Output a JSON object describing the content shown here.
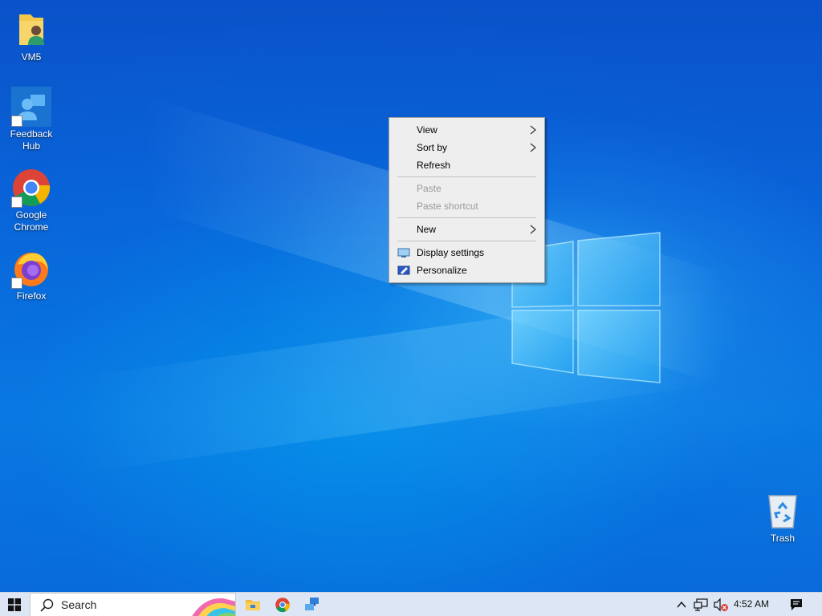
{
  "desktop": {
    "icons": [
      {
        "label": "VM5",
        "icon": "user-folder-icon"
      },
      {
        "label": "Feedback Hub",
        "icon": "feedback-hub-icon"
      },
      {
        "label": "Google Chrome",
        "icon": "chrome-icon"
      },
      {
        "label": "Firefox",
        "icon": "firefox-icon"
      },
      {
        "label": "Trash",
        "icon": "recycle-bin-icon"
      }
    ]
  },
  "context_menu": {
    "items": [
      {
        "label": "View",
        "submenu": true
      },
      {
        "label": "Sort by",
        "submenu": true
      },
      {
        "label": "Refresh"
      },
      {
        "label": "Paste",
        "disabled": true
      },
      {
        "label": "Paste shortcut",
        "disabled": true
      },
      {
        "label": "New",
        "submenu": true
      },
      {
        "label": "Display settings",
        "icon": "display-settings-icon"
      },
      {
        "label": "Personalize",
        "icon": "personalize-icon"
      }
    ]
  },
  "taskbar": {
    "search_placeholder": "Search",
    "pinned": [
      "file-explorer-icon",
      "chrome-icon",
      "remote-desktop-icon"
    ],
    "tray": [
      "chevron-up-icon",
      "network-icon",
      "volume-muted-icon"
    ],
    "clock": "4:52 AM",
    "notifications_icon": "action-center-icon"
  },
  "colors": {
    "desktop_blue": "#0a63d8",
    "taskbar_bg": "#dce6f4",
    "menu_bg": "#eeeeee",
    "disabled_text": "#9a9a9a"
  }
}
